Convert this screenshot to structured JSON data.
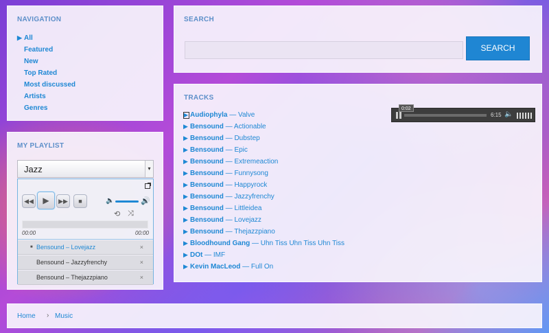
{
  "navigation": {
    "title": "NAVIGATION",
    "items": [
      "All",
      "Featured",
      "New",
      "Top Rated",
      "Most discussed",
      "Artists",
      "Genres"
    ],
    "active_marker": "▶"
  },
  "playlist": {
    "title": "MY PLAYLIST",
    "selected_genre": "Jazz",
    "time_current": "00:00",
    "time_total": "00:00",
    "volume_level": 0.7,
    "items": [
      {
        "label": "Bensound – Lovejazz",
        "active": true
      },
      {
        "label": "Bensound – Jazzyfrenchy",
        "active": false
      },
      {
        "label": "Bensound – Thejazzpiano",
        "active": false
      }
    ],
    "remove_glyph": "×"
  },
  "search": {
    "title": "SEARCH",
    "input_value": "",
    "button_label": "SEARCH"
  },
  "tracks": {
    "title": "TRACKS",
    "separator": " — ",
    "play_glyph": "▶",
    "items": [
      {
        "artist": "Audiophyla",
        "title": "Valve"
      },
      {
        "artist": "Bensound",
        "title": "Actionable"
      },
      {
        "artist": "Bensound",
        "title": "Dubstep"
      },
      {
        "artist": "Bensound",
        "title": "Epic"
      },
      {
        "artist": "Bensound",
        "title": "Extremeaction"
      },
      {
        "artist": "Bensound",
        "title": "Funnysong"
      },
      {
        "artist": "Bensound",
        "title": "Happyrock"
      },
      {
        "artist": "Bensound",
        "title": "Jazzyfrenchy"
      },
      {
        "artist": "Bensound",
        "title": "Littleidea"
      },
      {
        "artist": "Bensound",
        "title": "Lovejazz"
      },
      {
        "artist": "Bensound",
        "title": "Thejazzpiano"
      },
      {
        "artist": "Bloodhound Gang",
        "title": "Uhn Tiss Uhn Tiss Uhn Tiss"
      },
      {
        "artist": "DOt",
        "title": "IMF"
      },
      {
        "artist": "Kevin MacLeod",
        "title": "Full On"
      }
    ],
    "mini_player": {
      "tooltip_time": "0:02",
      "duration": "6:15"
    }
  },
  "breadcrumb": {
    "home": "Home",
    "separator": "›",
    "current": "Music"
  },
  "colors": {
    "accent": "#1e88d4",
    "panel_title": "#5d8fc9",
    "search_button": "#1f86d3"
  }
}
